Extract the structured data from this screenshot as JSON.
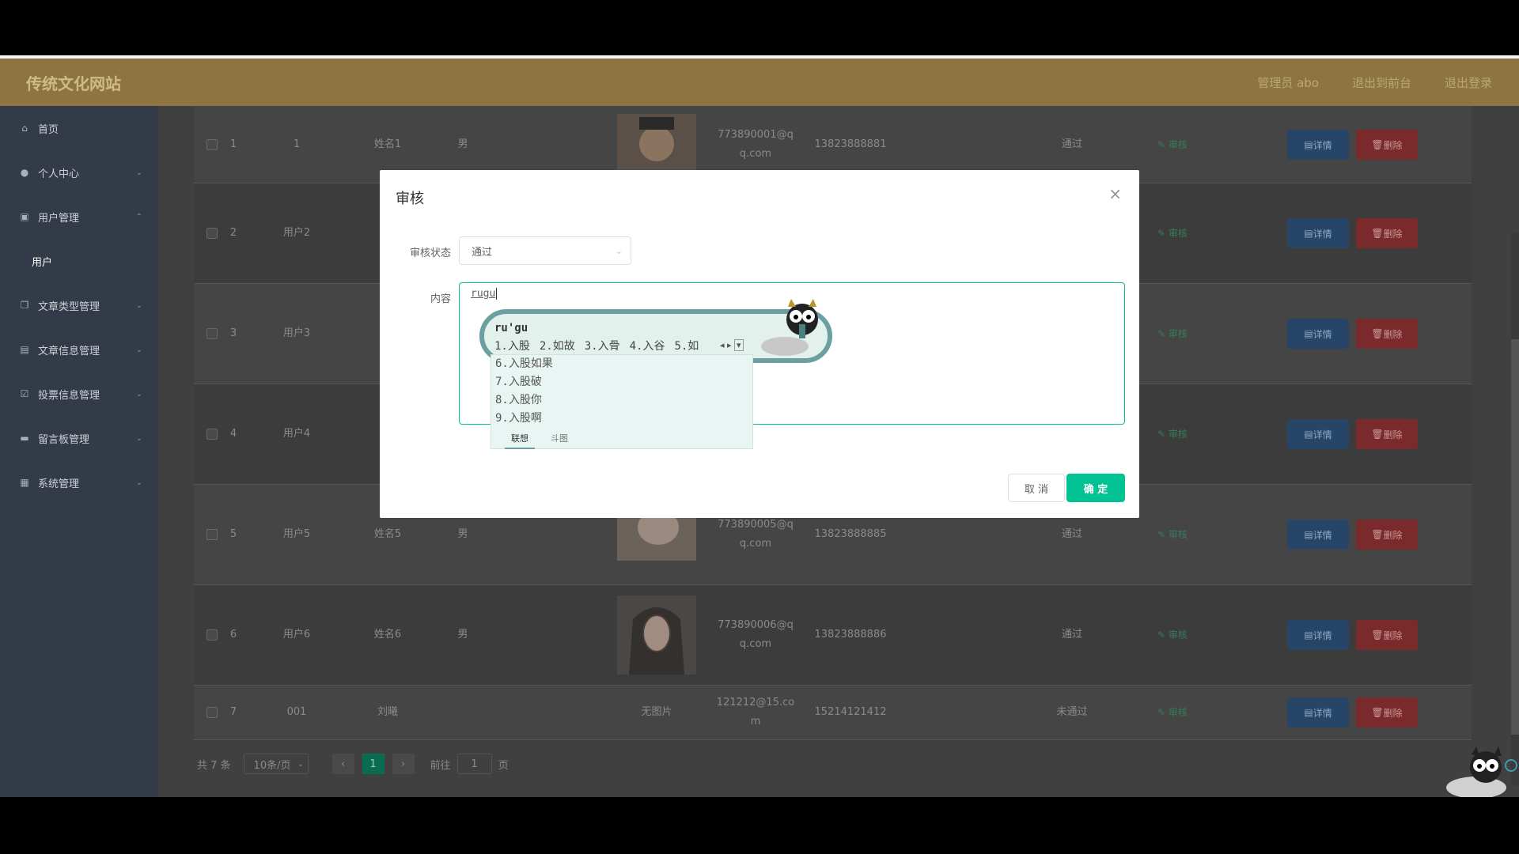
{
  "header": {
    "brand": "传统文化网站",
    "links": [
      "管理员 abo",
      "退出到前台",
      "退出登录"
    ]
  },
  "sidebar": {
    "items": [
      {
        "label": "首页",
        "icon": "home-icon"
      },
      {
        "label": "个人中心",
        "icon": "user-icon"
      },
      {
        "label": "用户管理",
        "icon": "users-icon"
      },
      {
        "label": "用户",
        "icon": ""
      },
      {
        "label": "文章类型管理",
        "icon": "copy-icon"
      },
      {
        "label": "文章信息管理",
        "icon": "document-icon"
      },
      {
        "label": "投票信息管理",
        "icon": "check-square-icon"
      },
      {
        "label": "留言板管理",
        "icon": "message-icon"
      },
      {
        "label": "系统管理",
        "icon": "settings-icon"
      }
    ]
  },
  "table": {
    "rows": [
      {
        "index": "1",
        "account": "1",
        "name": "姓名1",
        "gender": "男",
        "email": "773890001@qq.com",
        "phone": "13823888881",
        "status": "通过"
      },
      {
        "index": "2",
        "account": "用户2",
        "name": "",
        "gender": "",
        "email": "",
        "phone": "",
        "status": ""
      },
      {
        "index": "3",
        "account": "用户3",
        "name": "",
        "gender": "",
        "email": "",
        "phone": "",
        "status": ""
      },
      {
        "index": "4",
        "account": "用户4",
        "name": "",
        "gender": "",
        "email": "",
        "phone": "",
        "status": ""
      },
      {
        "index": "5",
        "account": "用户5",
        "name": "姓名5",
        "gender": "男",
        "email": "773890005@qq.com",
        "phone": "13823888885",
        "status": "通过"
      },
      {
        "index": "6",
        "account": "用户6",
        "name": "姓名6",
        "gender": "男",
        "email": "773890006@qq.com",
        "phone": "13823888886",
        "status": "通过"
      },
      {
        "index": "7",
        "account": "001",
        "name": "刘曦",
        "gender": "",
        "email": "121212@15.com",
        "phone": "15214121412",
        "status": "未通过",
        "image_text": "无图片"
      }
    ],
    "audit_label": "审核",
    "detail_label": "详情",
    "delete_label": "删除"
  },
  "pager": {
    "total": "共 7 条",
    "page_size": "10条/页",
    "current_page": "1",
    "goto_label": "前往",
    "goto_value": "1",
    "page_suffix": "页"
  },
  "dialog": {
    "title": "审核",
    "status_label": "审核状态",
    "status_value": "通过",
    "content_label": "内容",
    "content_value": "rugu",
    "cancel_label": "取 消",
    "ok_label": "确 定"
  },
  "ime": {
    "pinyin": "ru'gu",
    "candidates_row": [
      "1.入股",
      "2.如故",
      "3.入骨",
      "4.入谷",
      "5.如"
    ],
    "candidates_list": [
      "6.入股如果",
      "7.入股破",
      "8.入股你",
      "9.入股啊"
    ],
    "tabs": [
      "联想",
      "斗图"
    ]
  },
  "colors": {
    "header_bg": "#8d7440",
    "sidebar_bg": "#333b48",
    "accent": "#00c292"
  }
}
